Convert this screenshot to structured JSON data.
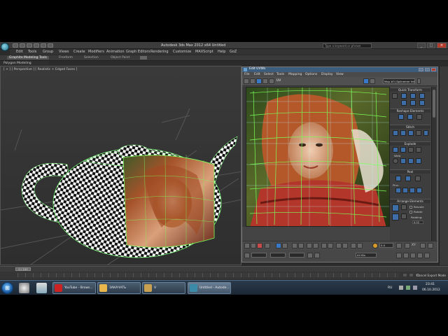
{
  "window": {
    "title": "Autodesk 3ds Max  2012 x64      Untitled",
    "search_placeholder": "Type a keyword or phrase"
  },
  "menu": [
    "Edit",
    "Tools",
    "Group",
    "Views",
    "Create",
    "Modifiers",
    "Animation",
    "Graph Editors",
    "Rendering",
    "Customize",
    "MAXScript",
    "Help",
    "GoZ"
  ],
  "ribbon": {
    "tabs": [
      "Graphite Modeling Tools",
      "Freeform",
      "Selection",
      "Object Paint"
    ],
    "sub_label": "Polygon Modeling"
  },
  "viewport": {
    "label": "[ + ] [ Perspective ] [ Realistic + Edged Faces ]"
  },
  "uv_editor": {
    "title": "Edit UVWs",
    "menu": [
      "File",
      "Edit",
      "Select",
      "Tools",
      "Mapping",
      "Options",
      "Display",
      "View"
    ],
    "uv_label": "UV",
    "map_dropdown": "Map #3 (Splinemer fete.kvadr...",
    "panel": {
      "quick_transform": "Quick Transform",
      "reshape": "Reshape Elements",
      "stitch": "Stitch",
      "explode": "Explode",
      "weld": "Weld",
      "peel": "Peel",
      "pins": "Pins:",
      "arrange": "Arrange Elements",
      "rescale": "Rescale",
      "rotate": "Rotate",
      "padding_label": "Padding:",
      "padding_value": "0.02"
    },
    "bottom": {
      "value_field": "0.0",
      "xy_label": "XY",
      "ids_dropdown": "All IDs"
    }
  },
  "timeline": {
    "frame": "0 / 100",
    "status": "Cancel Export Mode"
  },
  "taskbar": {
    "tasks": [
      "YouTube - Brows...",
      "ЗАКАЧАТЬ",
      "V",
      "Untitled - Autode..."
    ],
    "lang": "RU",
    "time": "23:41",
    "date": "06.10.2012"
  },
  "colors": {
    "uv_title_bar": "#3d5d7d",
    "accent_blue": "#3a78c8",
    "mesh_green": "#7cff5a"
  }
}
